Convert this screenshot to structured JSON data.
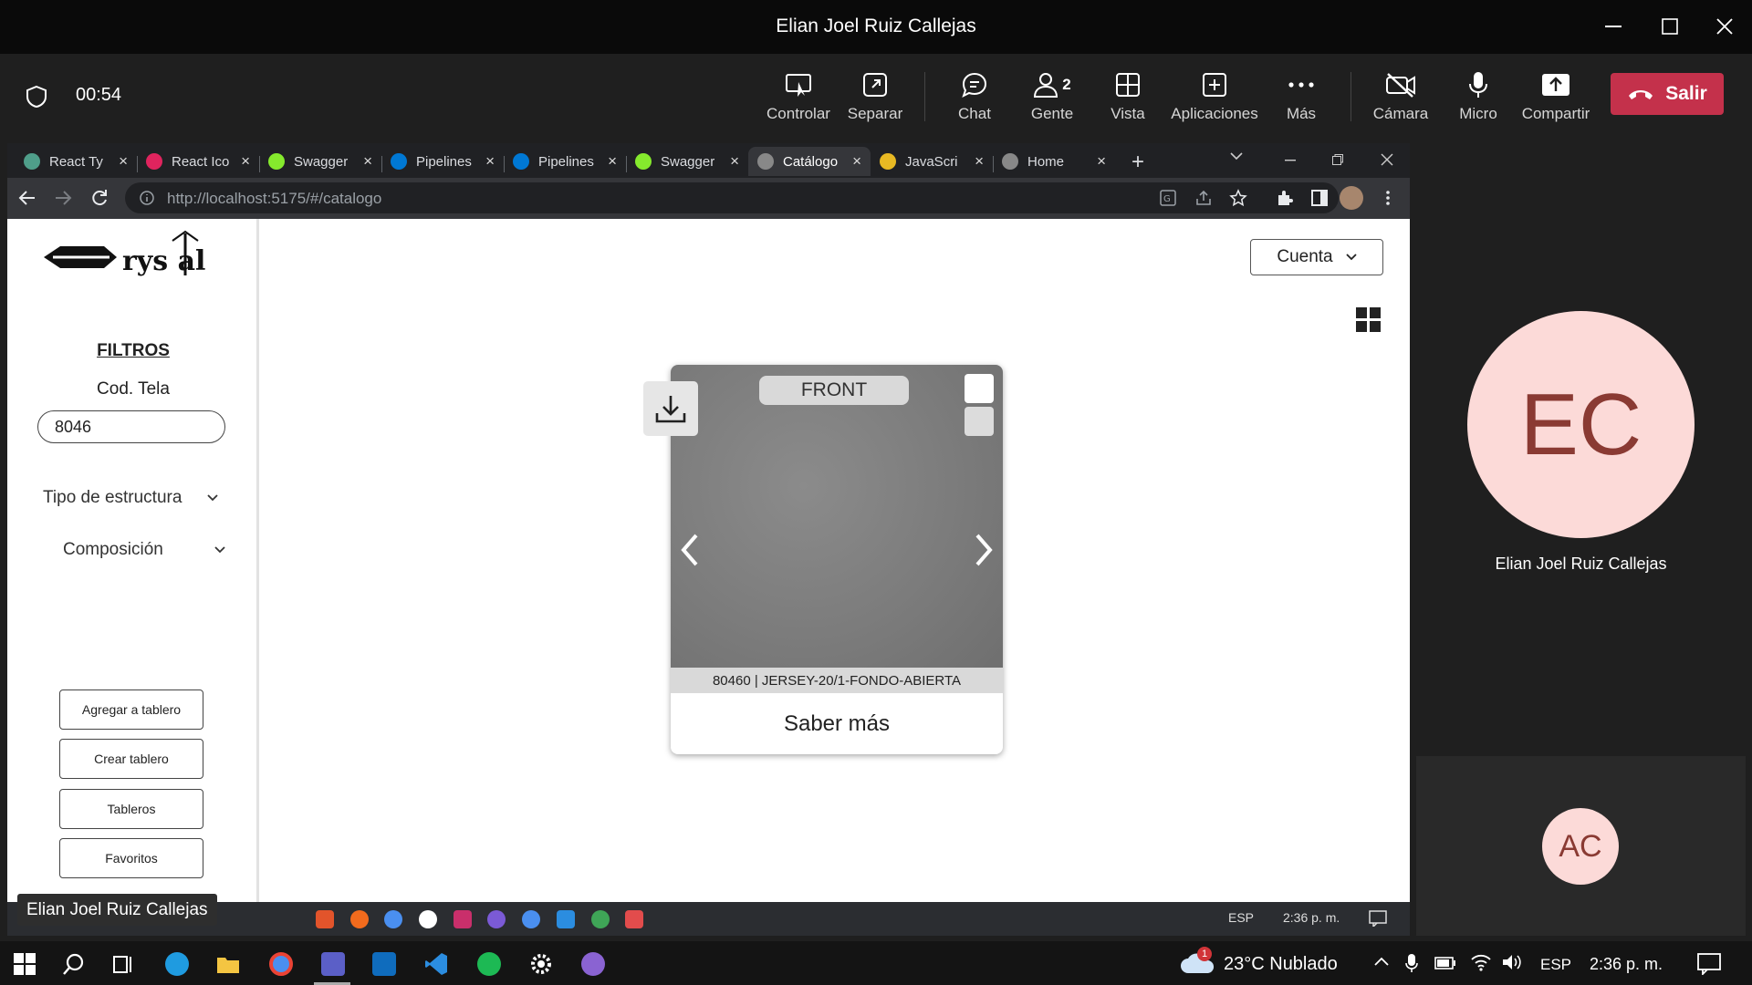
{
  "teams": {
    "window_title": "Elian Joel Ruiz Callejas",
    "timer": "00:54",
    "toolbar": {
      "control": "Controlar",
      "separate": "Separar",
      "chat": "Chat",
      "people": "Gente",
      "people_count": "2",
      "view": "Vista",
      "apps": "Aplicaciones",
      "more": "Más",
      "camera": "Cámara",
      "mic": "Micro",
      "share": "Compartir",
      "leave": "Salir"
    },
    "leave_color": "#c4314b"
  },
  "browser": {
    "tabs": [
      {
        "label": "React Ty",
        "icon": "react-icon",
        "color": "#4f9e8a"
      },
      {
        "label": "React Ico",
        "icon": "react-icons-icon",
        "color": "#e0245e"
      },
      {
        "label": "Swagger",
        "icon": "swagger-icon",
        "color": "#85ea2d"
      },
      {
        "label": "Pipelines",
        "icon": "azure-devops-icon",
        "color": "#0078d4"
      },
      {
        "label": "Pipelines",
        "icon": "azure-devops-icon",
        "color": "#0078d4"
      },
      {
        "label": "Swagger",
        "icon": "swagger-icon",
        "color": "#85ea2d"
      },
      {
        "label": "Catálogo",
        "icon": "crystal-logo-icon",
        "color": "#888888",
        "active": true
      },
      {
        "label": "JavaScri",
        "icon": "lock-icon",
        "color": "#e8b923"
      },
      {
        "label": "Home",
        "icon": "crystal-logo-icon",
        "color": "#888888"
      }
    ],
    "url": "http://localhost:5175/#/catalogo"
  },
  "app": {
    "logo_text": "rys al",
    "filters": {
      "title": "FILTROS",
      "cod_tela_label": "Cod. Tela",
      "cod_tela_value": "8046",
      "dropdowns": [
        "Tipo de estructura",
        "Composición"
      ]
    },
    "side_buttons": [
      "Agregar a tablero",
      "Crear tablero",
      "Tableros",
      "Favoritos"
    ],
    "account_label": "Cuenta",
    "card": {
      "badge": "FRONT",
      "caption": "80460 | JERSEY-20/1-FONDO-ABIERTA",
      "action": "Saber más"
    }
  },
  "shared_taskbar": {
    "lang": "ESP",
    "time": "2:36 p. m."
  },
  "participants": [
    {
      "initials": "EC",
      "name": "Elian Joel Ruiz Callejas"
    },
    {
      "initials": "AC"
    }
  ],
  "presenter_name": "Elian Joel Ruiz Callejas",
  "windows_taskbar": {
    "weather": "23°C  Nublado",
    "weather_badge": "1",
    "lang": "ESP",
    "time": "2:36 p. m."
  }
}
